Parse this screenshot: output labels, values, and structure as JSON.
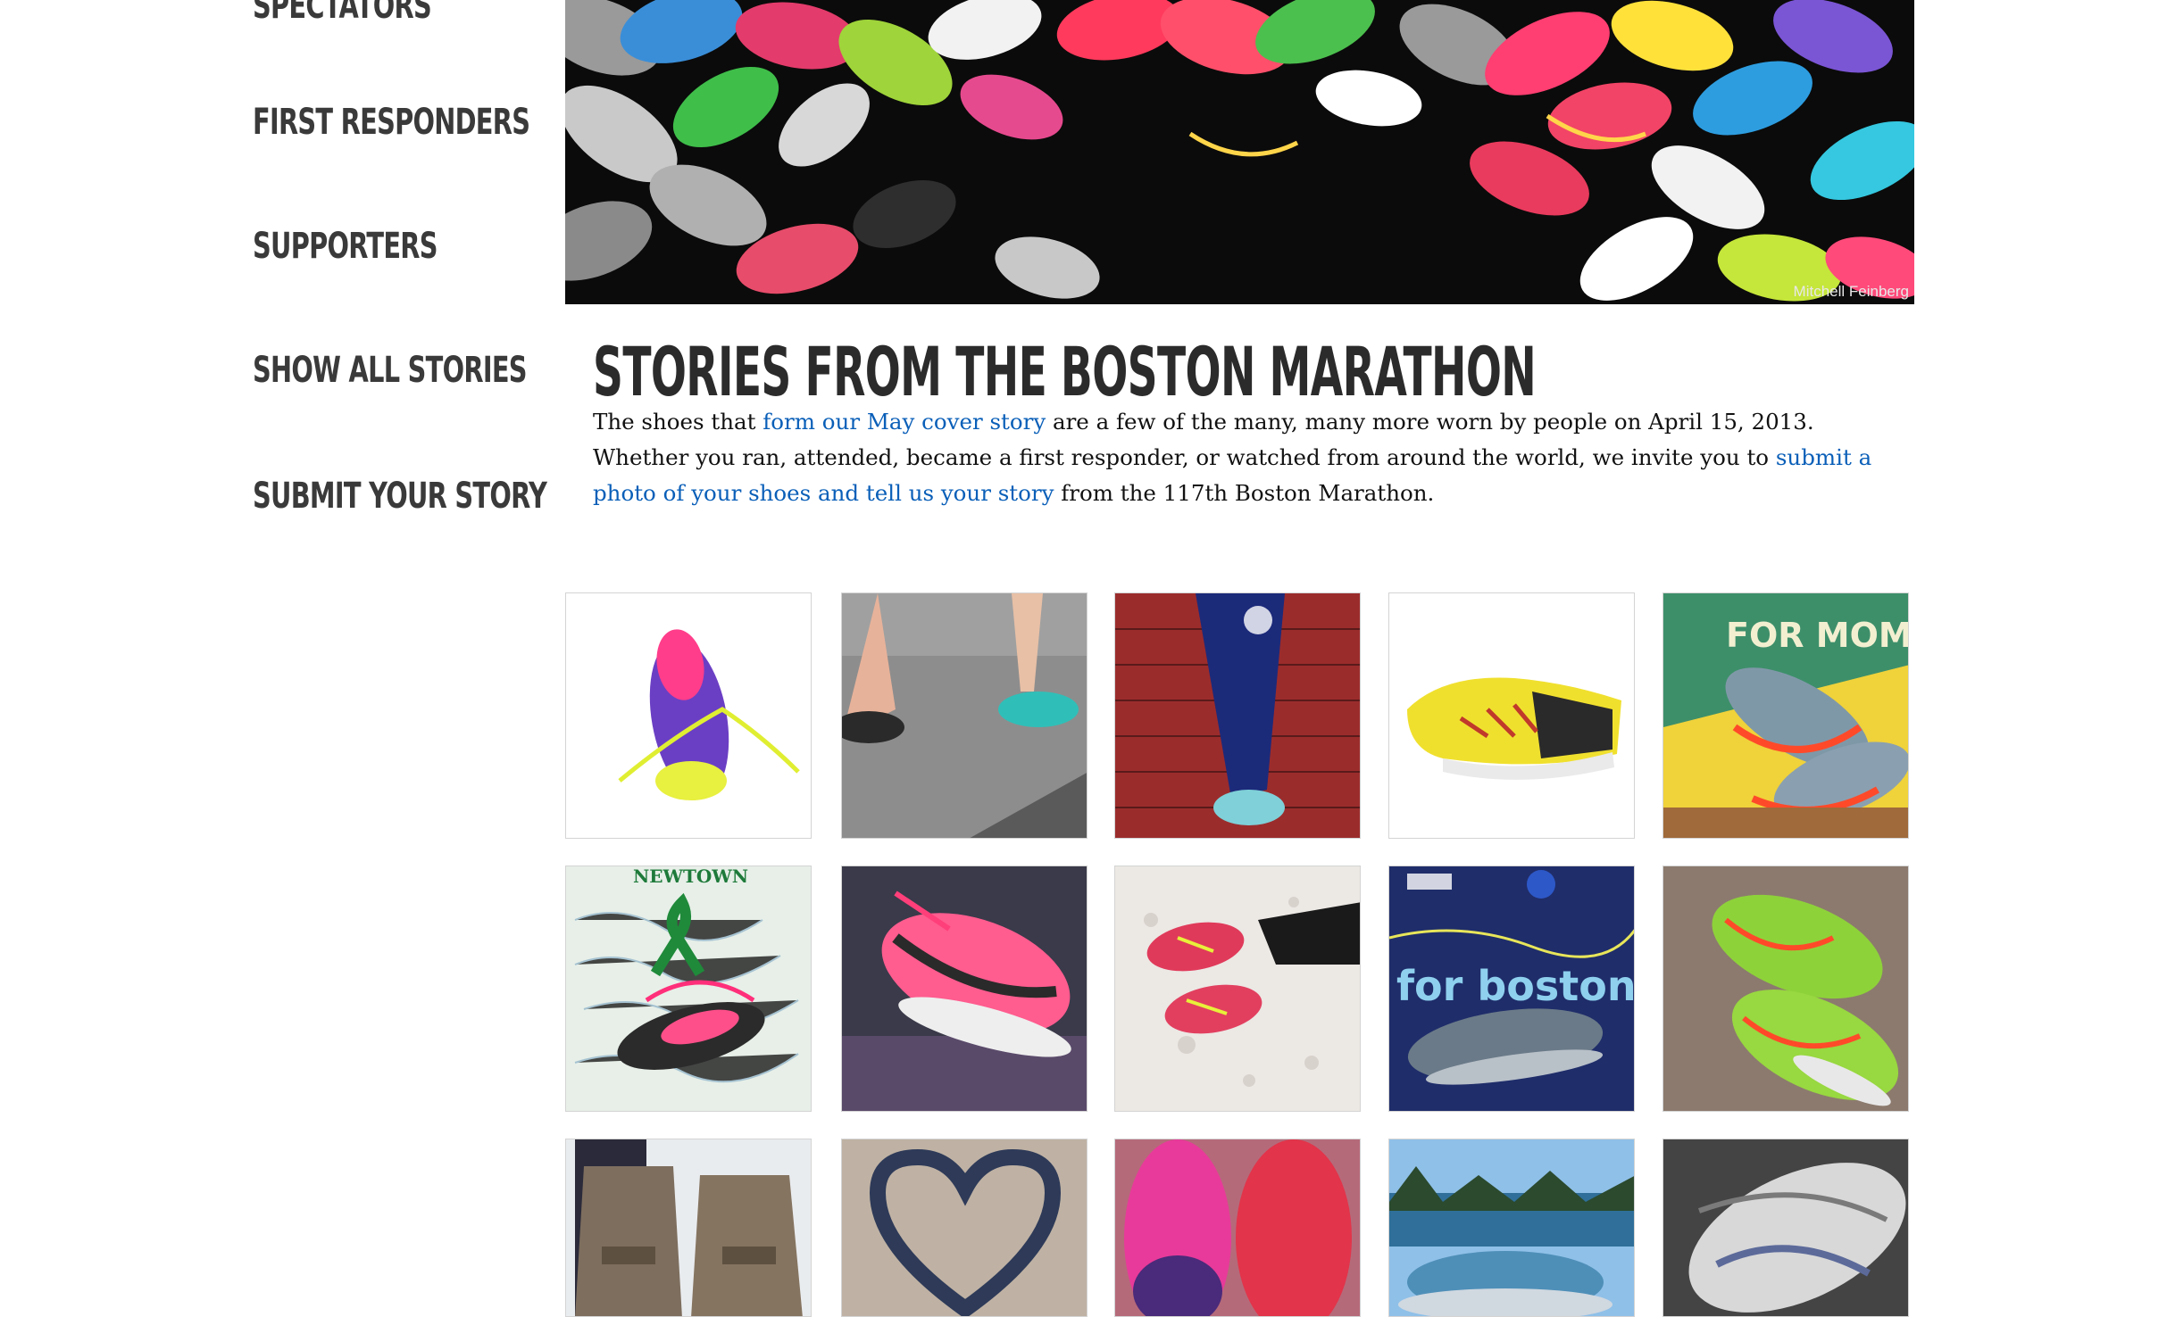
{
  "sidebar": {
    "items": [
      {
        "label": "Spectators"
      },
      {
        "label": "First Responders"
      },
      {
        "label": "Supporters"
      },
      {
        "label": "Show All Stories"
      },
      {
        "label": "Submit Your Story"
      }
    ]
  },
  "hero": {
    "credit": "Mitchell Feinberg"
  },
  "main": {
    "title": "Stories from the Boston Marathon",
    "intro": {
      "p1": "The shoes that ",
      "link1": "form our May cover story",
      "p2": " are a few of the many, many more worn by people on April 15, 2013. Whether you ran, attended, became a first responder, or watched from around the world, we invite you to ",
      "link2": "submit a photo of your shoes and tell us your story",
      "p3": " from the 117th Boston Marathon."
    }
  },
  "gallery": {
    "tiles": [
      {
        "caption_text": ""
      },
      {
        "caption_text": ""
      },
      {
        "caption_text": ""
      },
      {
        "caption_text": ""
      },
      {
        "caption_text": "FOR MOM"
      },
      {
        "caption_text": "NEWTOWN"
      },
      {
        "caption_text": ""
      },
      {
        "caption_text": ""
      },
      {
        "caption_text": "for boston"
      },
      {
        "caption_text": ""
      },
      {
        "caption_text": ""
      },
      {
        "caption_text": ""
      },
      {
        "caption_text": ""
      },
      {
        "caption_text": ""
      },
      {
        "caption_text": ""
      }
    ]
  },
  "colors": {
    "link": "#0a5fb8",
    "nav_text": "#3a3a3a",
    "title_text": "#2b2b2b"
  }
}
